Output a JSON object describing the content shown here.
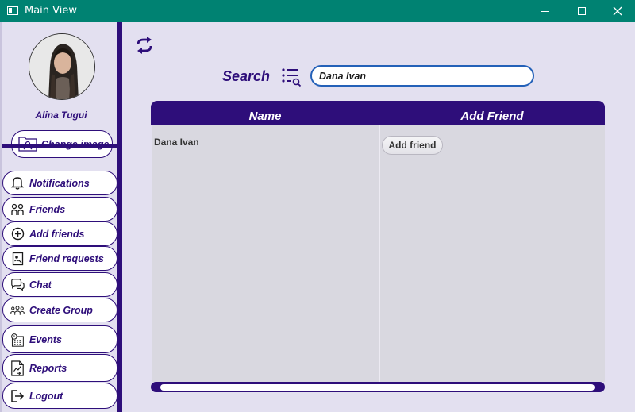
{
  "window": {
    "title": "Main View",
    "titlebar_color": "#008272"
  },
  "sidebar": {
    "user_name": "Alina Tugui",
    "change_image_label": "Change image",
    "items": [
      {
        "label": "Notifications",
        "icon": "bell-icon"
      },
      {
        "label": "Friends",
        "icon": "friends-icon"
      },
      {
        "label": "Add friends",
        "icon": "plus-circle-icon"
      },
      {
        "label": "Friend requests",
        "icon": "request-icon"
      },
      {
        "label": "Chat",
        "icon": "chat-icon"
      },
      {
        "label": "Create Group",
        "icon": "group-icon"
      },
      {
        "label": "Events",
        "icon": "calendar-icon"
      },
      {
        "label": "Reports",
        "icon": "report-icon"
      },
      {
        "label": "Logout",
        "icon": "logout-icon"
      }
    ]
  },
  "main": {
    "search_label": "Search",
    "search_value": "Dana Ivan",
    "table": {
      "columns": [
        "Name",
        "Add Friend"
      ],
      "rows": [
        {
          "name": "Dana Ivan",
          "action_label": "Add friend"
        }
      ]
    }
  },
  "colors": {
    "accent": "#2e0e7a",
    "background": "#e3e0f0",
    "search_border": "#2461b8"
  }
}
